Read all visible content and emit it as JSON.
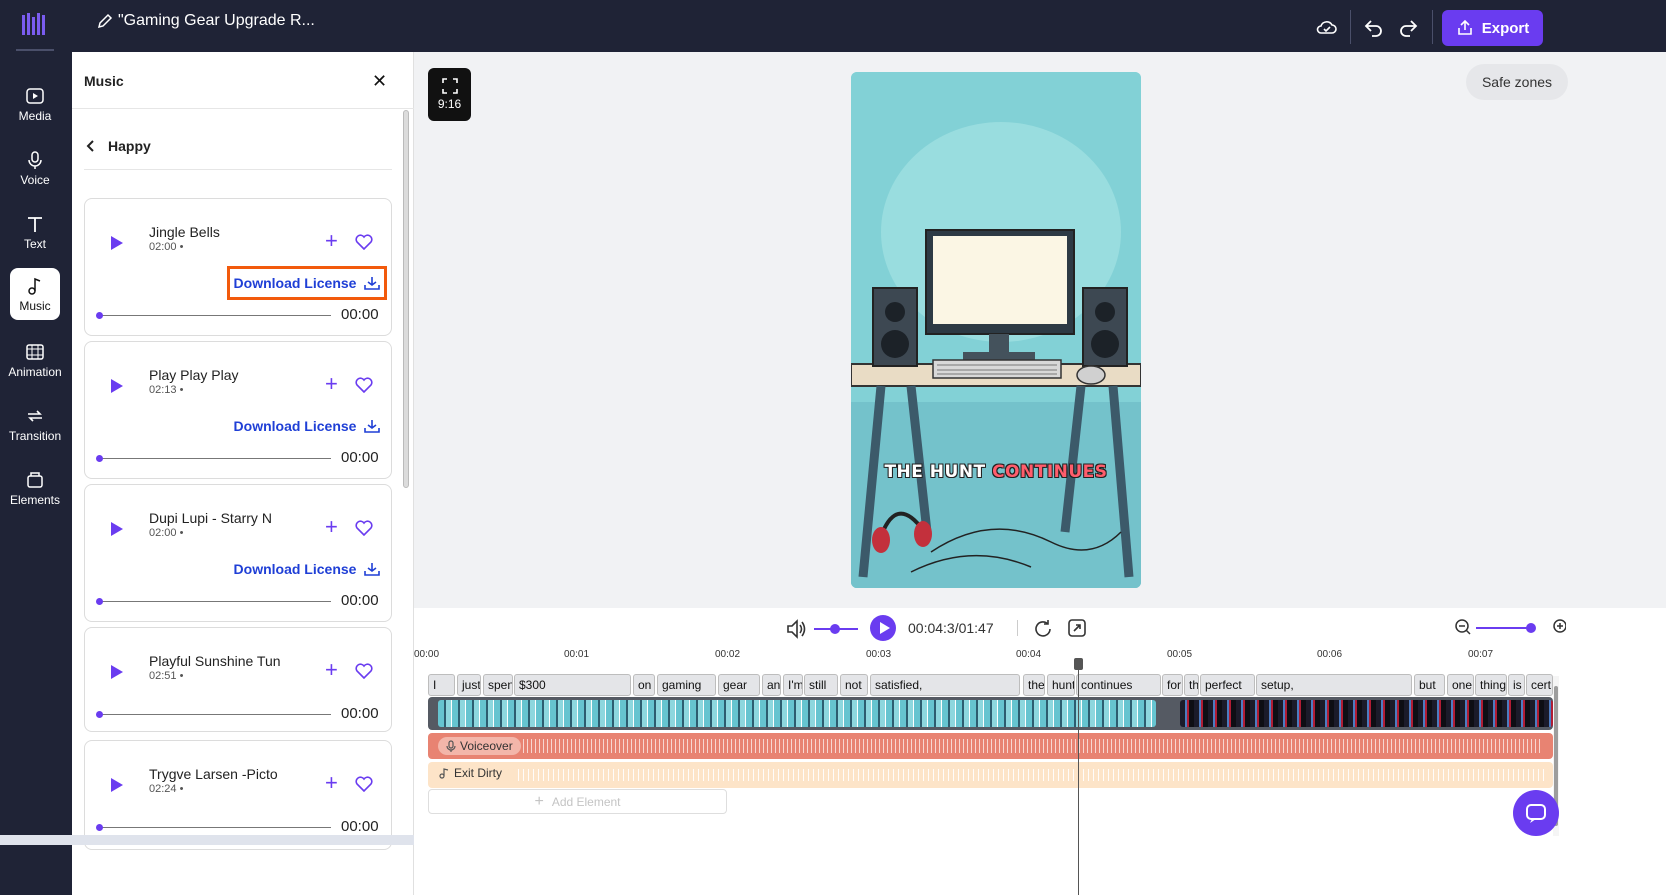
{
  "header": {
    "project_title": "\"Gaming Gear Upgrade R...",
    "export_label": "Export",
    "icons": [
      "cloud-sync-icon",
      "undo-icon",
      "redo-icon"
    ]
  },
  "nav": {
    "items": [
      {
        "label": "Media",
        "icon": "media-icon"
      },
      {
        "label": "Voice",
        "icon": "microphone-icon"
      },
      {
        "label": "Text",
        "icon": "text-icon"
      },
      {
        "label": "Music",
        "icon": "music-note-icon",
        "active": true
      },
      {
        "label": "Animation",
        "icon": "animation-icon"
      },
      {
        "label": "Transition",
        "icon": "transition-icon"
      },
      {
        "label": "Elements",
        "icon": "elements-icon"
      }
    ]
  },
  "panel": {
    "title": "Music",
    "category": "Happy",
    "tracks": [
      {
        "name": "Jingle Bells",
        "duration": "02:00 •",
        "license_label": "Download License",
        "time": "00:00",
        "highlighted": true
      },
      {
        "name": "Play Play Play",
        "duration": "02:13 •",
        "license_label": "Download License",
        "time": "00:00"
      },
      {
        "name": "Dupi Lupi - Starry N",
        "duration": "02:00 •",
        "license_label": "Download License",
        "time": "00:00"
      },
      {
        "name": "Playful Sunshine Tun",
        "duration": "02:51 •",
        "license_label": "",
        "time": "00:00"
      },
      {
        "name": "Trygve Larsen -Picto",
        "duration": "02:24 •",
        "license_label": "",
        "time": "00:00"
      }
    ]
  },
  "canvas": {
    "aspect_ratio": "9:16",
    "safe_zones_label": "Safe zones",
    "caption_part1": "THE HUNT",
    "caption_part2": "CONTINUES"
  },
  "player": {
    "current_time": "00:04:3/01:47"
  },
  "timeline": {
    "ticks": [
      "00:00",
      "00:01",
      "00:02",
      "00:03",
      "00:04",
      "00:05",
      "00:06",
      "00:07"
    ],
    "words": [
      "I",
      "just",
      "spent",
      "$300",
      "on",
      "gaming",
      "gear",
      "an",
      "I'm",
      "still",
      "not",
      "satisfied,",
      "the",
      "hunt",
      "continues",
      "for",
      "th",
      "perfect",
      "setup,",
      "but",
      "one",
      "thing",
      "is",
      "cert"
    ],
    "voiceover_label": "Voiceover",
    "music_label": "Exit Dirty",
    "add_element_label": "Add Element"
  },
  "colors": {
    "accent": "#6a3cf0",
    "sidebar": "#1f2336",
    "license_link": "#1f3fd6",
    "highlight": "#f25a0c",
    "voice_track": "#e88372",
    "music_track": "#fde4c8"
  }
}
